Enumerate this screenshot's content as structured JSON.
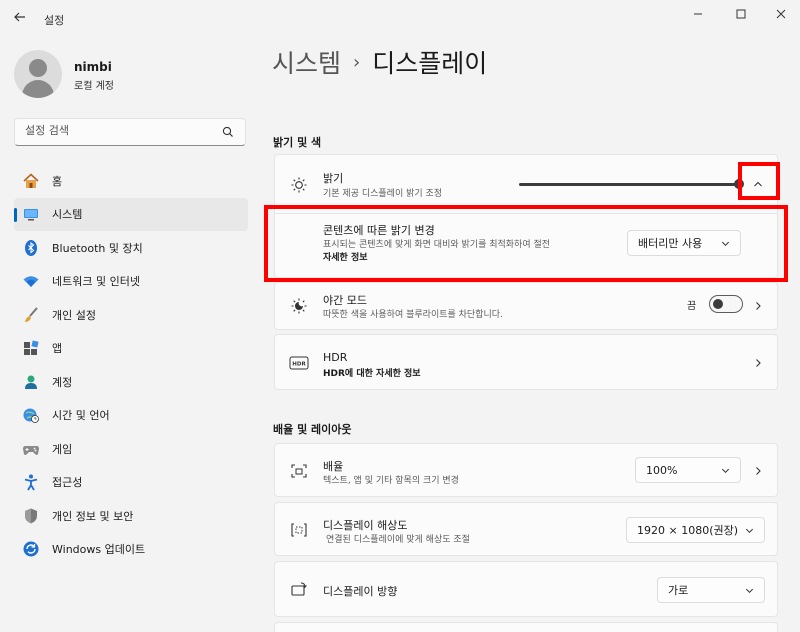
{
  "window": {
    "title": "설정",
    "back_icon": "back-arrow-icon",
    "controls": [
      "minimize-icon",
      "maximize-icon",
      "close-icon"
    ]
  },
  "profile": {
    "name": "nimbi",
    "account_type": "로컬 계정"
  },
  "search": {
    "placeholder": "설정 검색"
  },
  "nav": {
    "items": [
      {
        "label": "홈",
        "icon": "home-icon",
        "active": false
      },
      {
        "label": "시스템",
        "icon": "system-icon",
        "active": true
      },
      {
        "label": "Bluetooth 및 장치",
        "icon": "bluetooth-icon",
        "active": false
      },
      {
        "label": "네트워크 및 인터넷",
        "icon": "wifi-icon",
        "active": false
      },
      {
        "label": "개인 설정",
        "icon": "brush-icon",
        "active": false
      },
      {
        "label": "앱",
        "icon": "apps-icon",
        "active": false
      },
      {
        "label": "계정",
        "icon": "account-icon",
        "active": false
      },
      {
        "label": "시간 및 언어",
        "icon": "globe-clock-icon",
        "active": false
      },
      {
        "label": "게임",
        "icon": "gamepad-icon",
        "active": false
      },
      {
        "label": "접근성",
        "icon": "accessibility-icon",
        "active": false
      },
      {
        "label": "개인 정보 및 보안",
        "icon": "shield-icon",
        "active": false
      },
      {
        "label": "Windows 업데이트",
        "icon": "update-icon",
        "active": false
      }
    ]
  },
  "breadcrumb": {
    "parent": "시스템",
    "separator": "›",
    "current": "디스플레이"
  },
  "sections": {
    "brightness_color": {
      "heading": "밝기 및 색",
      "brightness": {
        "title": "밝기",
        "subtitle": "기본 제공 디스플레이 밝기 조정",
        "value_fraction": 1.0,
        "expanded": true
      },
      "content_adaptive": {
        "title": "콘텐츠에 따른 밝기 변경",
        "subtitle": "표시되는 콘텐츠에 맞게 화면 대비와 밝기를 최적화하여 절전",
        "link": "자세한 정보",
        "dropdown_value": "배터리만 사용"
      },
      "night_light": {
        "title": "야간 모드",
        "subtitle": "따뜻한 색을 사용하여 블루라이트를 차단합니다.",
        "toggle_label": "끔",
        "toggle_on": false
      },
      "hdr": {
        "title": "HDR",
        "link": "HDR에 대한 자세한 정보"
      }
    },
    "scale_layout": {
      "heading": "배율 및 레이아웃",
      "scale": {
        "title": "배율",
        "subtitle": "텍스트, 앱 및 기타 항목의 크기 변경",
        "dropdown_value": "100%"
      },
      "resolution": {
        "title": "디스플레이 해상도",
        "subtitle": "연결된 디스플레이에 맞게 해상도 조절",
        "dropdown_value": "1920 × 1080(권장)"
      },
      "orientation": {
        "title": "디스플레이 방향",
        "dropdown_value": "가로"
      }
    }
  },
  "colors": {
    "accent": "#0067c0",
    "highlight": "#ff0000",
    "background": "#f3f3f3",
    "card": "#fbfbfb"
  }
}
